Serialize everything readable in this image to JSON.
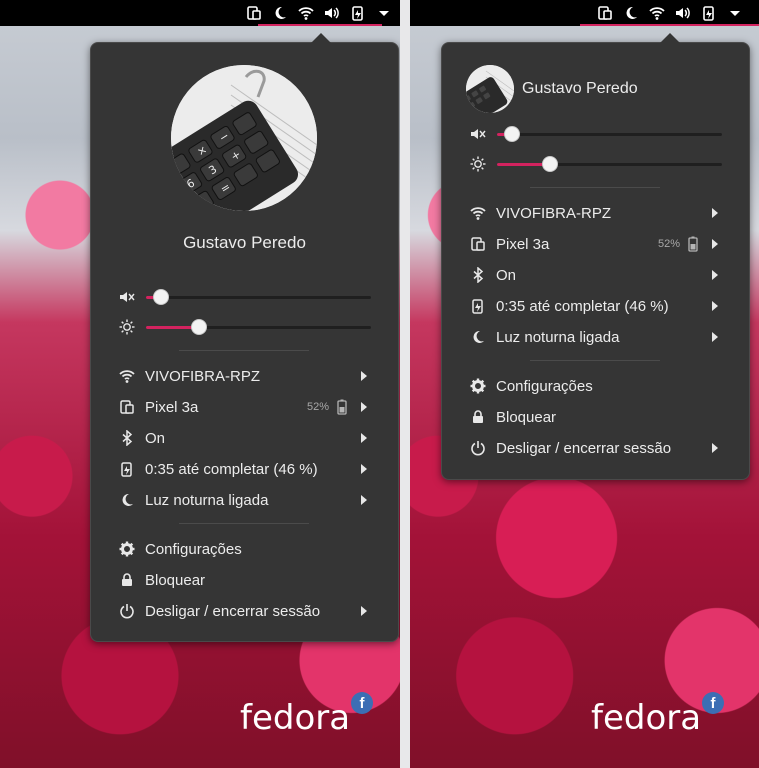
{
  "topbar": {
    "icons": [
      "phone-icon",
      "moon-icon",
      "wifi-icon",
      "volume-icon",
      "battery-charging-icon",
      "dropdown-arrow-icon"
    ]
  },
  "user": {
    "name": "Gustavo Peredo"
  },
  "sliders": {
    "volume": {
      "icon": "volume-muted-icon",
      "level": 0.05
    },
    "brightness": {
      "icon": "brightness-icon",
      "level": 0.24
    }
  },
  "menu": {
    "wifi": {
      "label": "VIVOFIBRA-RPZ",
      "icon": "wifi-icon"
    },
    "device": {
      "label": "Pixel 3a",
      "icon": "phone-icon",
      "battery_pct": "52%"
    },
    "bluetooth": {
      "label": "On",
      "icon": "bluetooth-icon"
    },
    "power": {
      "label": "0:35 até completar (46 %)",
      "icon": "battery-charging-icon"
    },
    "night_light": {
      "label": "Luz noturna ligada",
      "icon": "moon-icon"
    },
    "settings": {
      "label": "Configurações",
      "icon": "gear-icon"
    },
    "lock": {
      "label": "Bloquear",
      "icon": "lock-icon"
    },
    "shutdown": {
      "label": "Desligar / encerrar sessão",
      "icon": "power-icon"
    }
  },
  "branding": {
    "logo_text": "fedora",
    "badge": "f"
  },
  "colors": {
    "accent": "#d3235f",
    "menu_bg": "#353535",
    "text": "#ececec"
  }
}
